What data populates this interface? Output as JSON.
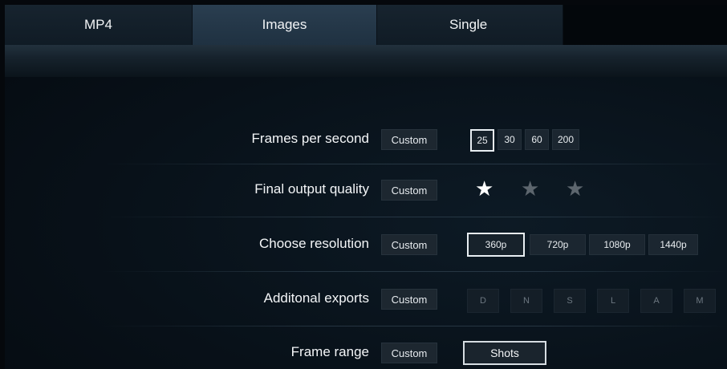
{
  "tabs": [
    {
      "label": "MP4",
      "active": false
    },
    {
      "label": "Images",
      "active": true
    },
    {
      "label": "Single",
      "active": false
    }
  ],
  "rows": {
    "fps": {
      "label": "Frames per second",
      "custom": "Custom",
      "options": [
        "25",
        "30",
        "60",
        "200"
      ],
      "selected": "25"
    },
    "quality": {
      "label": "Final output quality",
      "custom": "Custom",
      "stars_total": 3,
      "stars_filled": 1,
      "star_icon": "star-icon"
    },
    "resolution": {
      "label": "Choose resolution",
      "custom": "Custom",
      "options": [
        "360p",
        "720p",
        "1080p",
        "1440p"
      ],
      "selected": "360p"
    },
    "exports": {
      "label": "Additonal exports",
      "custom": "Custom",
      "options": [
        "D",
        "N",
        "S",
        "L",
        "A",
        "M"
      ]
    },
    "range": {
      "label": "Frame range",
      "custom": "Custom",
      "value": "Shots"
    }
  },
  "colors": {
    "background": "#081119",
    "active_tab": "#2a3e50",
    "inactive_tab": "#17242f",
    "selected_border": "#e8eef2",
    "star_on": "#ffffff",
    "star_off": "#5d666e"
  }
}
